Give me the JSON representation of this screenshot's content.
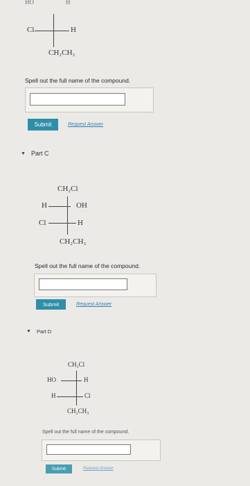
{
  "partB": {
    "top_left": "HO",
    "top_right": "H",
    "left": "Cl",
    "right": "H",
    "bottom": "CH₂CH₃",
    "prompt": "Spell out the full name of the compound.",
    "input_value": "",
    "submit_label": "Submit",
    "request_label": "Request Answer"
  },
  "partC": {
    "header": "Part C",
    "top": "CH₂Cl",
    "row1_left": "H",
    "row1_right": "OH",
    "row2_left": "Cl",
    "row2_right": "H",
    "bottom": "CH₂CH₃",
    "prompt": "Spell out the full name of the compound.",
    "input_value": "",
    "submit_label": "Submit",
    "request_label": "Request Answer"
  },
  "partD": {
    "header": "Part D",
    "top": "CH₂Cl",
    "row1_left": "HO",
    "row1_right": "H",
    "row2_left": "H",
    "row2_right": "Cl",
    "bottom": "CH₂CH₃",
    "prompt": "Spell out the full name of the compound.",
    "input_value": "",
    "submit_label": "Submit",
    "request_label": "Request Answer"
  }
}
